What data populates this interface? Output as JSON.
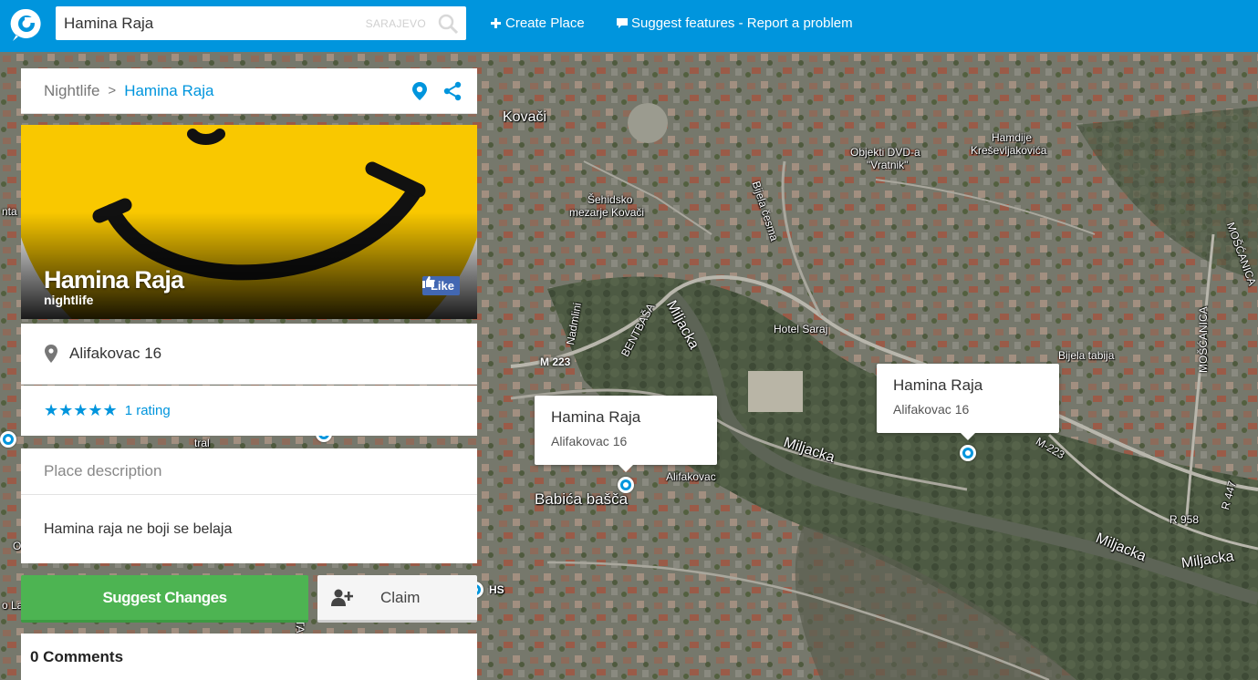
{
  "header": {
    "search_value": "Hamina Raja",
    "search_city": "SARAJEVO",
    "create_place": "Create Place",
    "suggest_features": "Suggest features - Report a problem"
  },
  "breadcrumb": {
    "parent": "Nightlife",
    "separator": ">",
    "current": "Hamina Raja"
  },
  "place": {
    "name": "Hamina Raja",
    "category": "nightlife",
    "facebook_like": "Like",
    "address": "Alifakovac 16",
    "stars": "★★★★★",
    "rating_count": "1 rating",
    "description_heading": "Place description",
    "description": "Hamina raja ne boji se belaja"
  },
  "actions": {
    "suggest_changes": "Suggest Changes",
    "claim": "Claim"
  },
  "comments": {
    "title": "0 Comments"
  },
  "map": {
    "popups": [
      {
        "title": "Hamina Raja",
        "address": "Alifakovac 16"
      },
      {
        "title": "Hamina Raja",
        "address": "Alifakovac 16"
      }
    ],
    "labels": {
      "kovaci": "Kovači",
      "dvd_line1": "Objekti DVD-a",
      "dvd_line2": "\"Vratnik\"",
      "hamdije_line1": "Hamdije",
      "hamdije_line2": "Kreševljakovića",
      "sehidsko_line1": "Šehidsko",
      "sehidsko_line2": "mezarje Kovači",
      "bijela_cesma": "Bijela česma",
      "nadmlini": "Nadmlini",
      "bentbasa": "BENTBAŠA",
      "miljacka_1": "Miljacka",
      "hotel_saraj": "Hotel Saraj",
      "m223_1": "M 223",
      "bijela_tabija": "Bijela tabija",
      "moscanica_1": "MOŠĆANICA",
      "moscanica_2": "MOŠĆANICA",
      "miljacka_2": "Miljacka",
      "m223_2": "M-223",
      "alifakovac": "Alifakovac",
      "babica_basca": "Babića bašča",
      "r958": "R 958",
      "r447": "R 447",
      "miljacka_3": "Miljacka",
      "miljacka_4": "Miljacka",
      "hs": "HS",
      "tral": "tral",
      "nta": "nta",
      "left_o": "O",
      "left_ola": "o La",
      "sta": "STA"
    }
  }
}
